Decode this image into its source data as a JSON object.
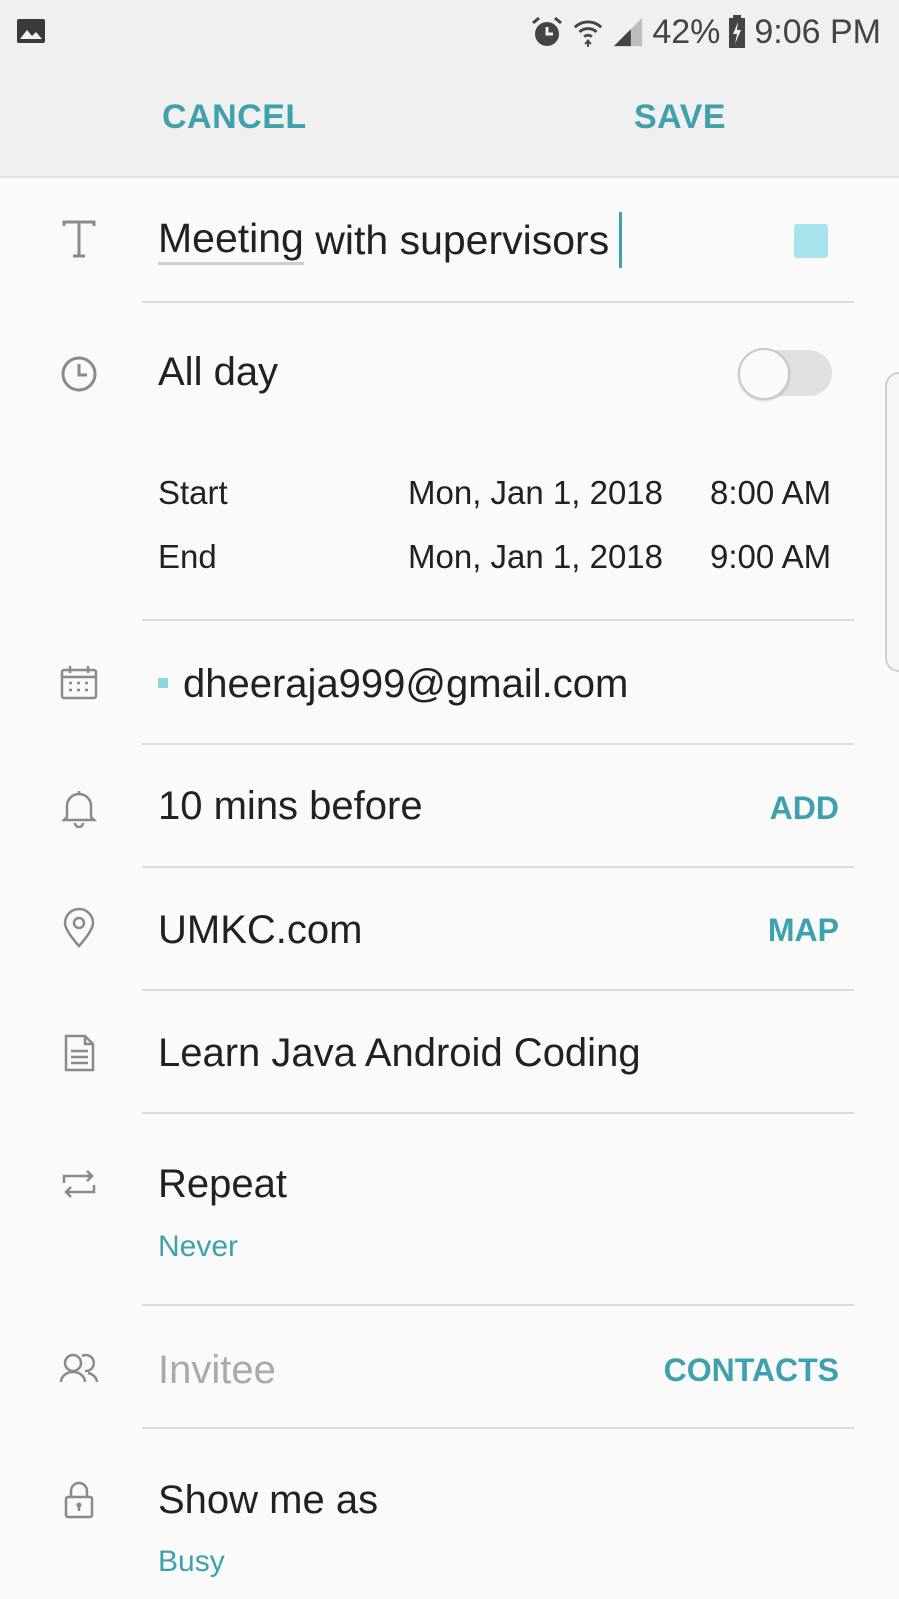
{
  "status_bar": {
    "battery": "42%",
    "time": "9:06 PM",
    "icons": [
      "gallery-icon",
      "alarm-icon",
      "wifi-icon",
      "signal-icon",
      "battery-charging-icon"
    ]
  },
  "toolbar": {
    "cancel_label": "CANCEL",
    "save_label": "SAVE"
  },
  "event": {
    "title": "Meeting with supervisors",
    "title_first_word": "Meeting",
    "title_rest": " with supervisors",
    "color": "#a6e3ec",
    "all_day_label": "All day",
    "all_day_on": false,
    "start_label": "Start",
    "start_date": "Mon, Jan 1, 2018",
    "start_time": "8:00 AM",
    "end_label": "End",
    "end_date": "Mon, Jan 1, 2018",
    "end_time": "9:00 AM",
    "calendar_account": "dheeraja999@gmail.com",
    "reminder": "10 mins before",
    "reminder_action": "ADD",
    "location": "UMKC.com",
    "location_action": "MAP",
    "notes": "Learn Java Android Coding",
    "repeat_label": "Repeat",
    "repeat_value": "Never",
    "invitee_placeholder": "Invitee",
    "invitee_action": "CONTACTS",
    "show_me_as_label": "Show me as",
    "show_me_as_value": "Busy"
  },
  "colors": {
    "accent": "#3ea1ad",
    "background": "#fafafa",
    "bar": "#f0f0f0"
  }
}
